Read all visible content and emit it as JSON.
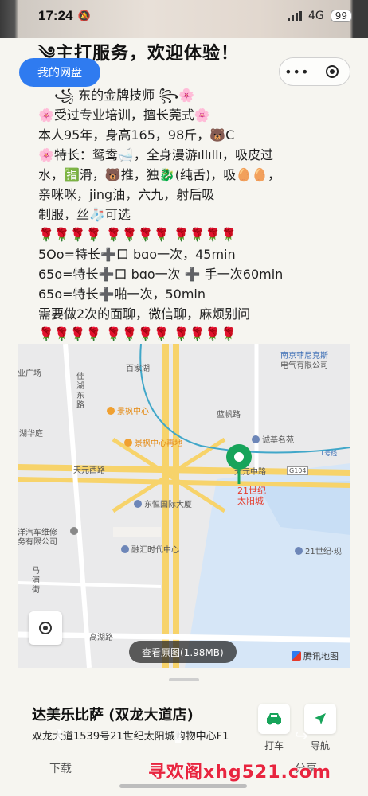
{
  "status_bar": {
    "time": "17:24",
    "network": "4G",
    "battery": "99"
  },
  "header": {
    "headline": "༄主打服务，欢迎体验！",
    "cloud_button": "我的网盘",
    "capsule": {
      "more": "•••"
    }
  },
  "post_lines": [
    "꧁ 东的金牌技师 ꧂🌸",
    "🌸受过专业培训，擅长莞式🌸",
    "本人95年，身高165，98斤，🐻C",
    "🌸特长：鸳鸯🛁，全身漫游ıllıllı，吸皮过",
    "水，🈯滑，🐻推，独🐉(纯舌)，吸🥚🥚，",
    "亲咪咪，jing油，六九，射后吸",
    "制服，丝🧦可选",
    "🌹🌹🌹🌹 🌹🌹🌹🌹 🌹🌹🌹🌹",
    "5Oo=特长➕口 bɑo一次，45min",
    "65o=特长➕口 bɑo一次 ➕ 手一次60min",
    "65o=特长➕啪一次，50min",
    "需要做2次的面聊，微信聊，麻烦别问",
    "🌹🌹🌹🌹 🌹🌹🌹🌹 🌹🌹🌹🌹"
  ],
  "map": {
    "labels": {
      "nanjing_fairchild": "南京菲尼克斯",
      "fairchild_electric": "电气有限公司",
      "square": "业广场",
      "baijiahu": "百家湖",
      "jiadong_rd_1": "佳",
      "jiadong_rd_2": "湖",
      "jiadong_rd_3": "东",
      "jiadong_rd_4": "路",
      "jingfeng_center": "景枫中心",
      "lanfan_rd": "蓝帆路",
      "huhuayuan": "湖华庭",
      "jingfeng_center_2": "景枫中心再地",
      "chengji_garden": "诚基名苑",
      "line1": "1号线",
      "tianyuan_west_rd": "天元西路",
      "tianyuan_middle_rd": "天元中路",
      "g104": "G104",
      "sun_city_1": "21世纪",
      "sun_city_2": "太阳城",
      "dongheng_building": "东恒国际大厦",
      "auto_repair_1": "洋汽车维修",
      "auto_repair_2": "务有限公司",
      "ronghui_center": "融汇时代中心",
      "century_now": "21世纪·现",
      "ma": "马",
      "pu": "浦",
      "street": "街",
      "gaohu_rd": "高湖路"
    },
    "view_original": "查看原图(1.98MB)",
    "tencent_map": "腾讯地图"
  },
  "place": {
    "name": "达美乐比萨 (双龙大道店)",
    "address": "双龙大道1539号21世纪太阳城购物中心F1"
  },
  "actions": {
    "taxi": "打车",
    "navigate": "导航"
  },
  "overlay": {
    "download": "下载",
    "share": "分享"
  },
  "watermark": "寻欢阁xhg521.com",
  "colors": {
    "accent_blue": "#2f7bf0",
    "map_pin": "#17a45a",
    "watermark": "#e8253f"
  }
}
